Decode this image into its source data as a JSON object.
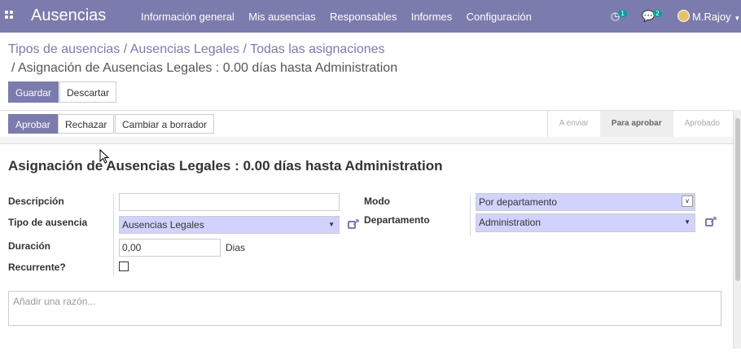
{
  "app": {
    "name": "Ausencias",
    "menu": [
      "Información general",
      "Mis ausencias",
      "Responsables",
      "Informes",
      "Configuración"
    ],
    "activity_count": "1",
    "message_count": "2",
    "user": "M.Rajoy"
  },
  "breadcrumb": {
    "path": "Tipos de ausencias / Ausencias Legales / Todas las asignaciones",
    "current": "/ Asignación de Ausencias Legales : 0.00 días hasta Administration"
  },
  "actions": {
    "save": "Guardar",
    "discard": "Descartar"
  },
  "workflow": {
    "buttons": [
      "Aprobar",
      "Rechazar",
      "Cambiar a borrador"
    ],
    "stages": [
      {
        "label": "A enviar",
        "active": false
      },
      {
        "label": "Para aprobar",
        "active": true
      },
      {
        "label": "Aprobado",
        "active": false
      }
    ]
  },
  "form": {
    "title": "Asignación de Ausencias Legales : 0.00 días hasta Administration",
    "labels": {
      "description": "Descripción",
      "leave_type": "Tipo de ausencia",
      "duration": "Duración",
      "recurring": "Recurrente?",
      "mode": "Modo",
      "department": "Departamento"
    },
    "values": {
      "description": "",
      "leave_type": "Ausencias Legales",
      "duration": "0,00",
      "duration_unit": "Dias",
      "recurring": false,
      "mode": "Por departamento",
      "department": "Administration"
    },
    "reason_placeholder": "Añadir una razón..."
  },
  "colors": {
    "brand": "#7c7bad",
    "required_field": "#d2d2ff",
    "badge": "#00a09d"
  }
}
